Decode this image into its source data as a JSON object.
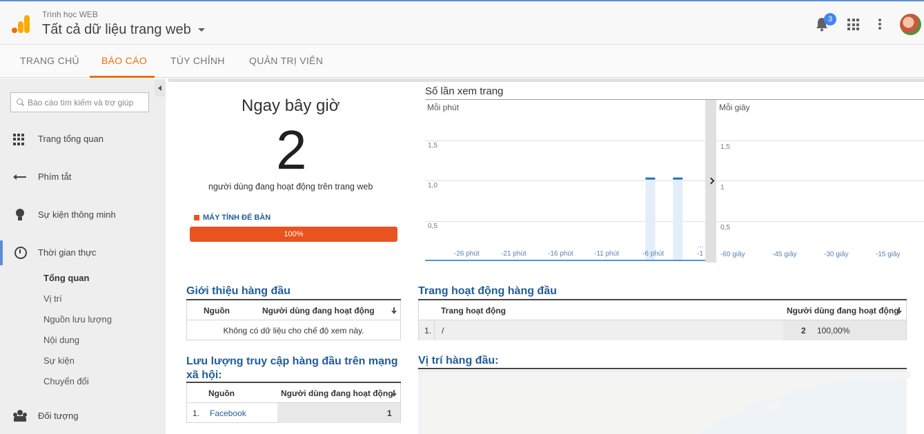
{
  "header": {
    "account": "Trình học WEB",
    "property": "Tất cả dữ liệu trang web",
    "notifications_count": "3"
  },
  "tabs": [
    {
      "label": "TRANG CHỦ",
      "active": false
    },
    {
      "label": "BÁO CÁO",
      "active": true
    },
    {
      "label": "TÙY CHỈNH",
      "active": false
    },
    {
      "label": "QUẢN TRỊ VIÊN",
      "active": false
    }
  ],
  "sidebar": {
    "search_placeholder": "Báo cáo tìm kiếm và trợ giúp",
    "items": [
      {
        "label": "Trang tổng quan",
        "icon": "dashboard-icon"
      },
      {
        "label": "Phím tắt",
        "icon": "shortcut-icon"
      },
      {
        "label": "Sự kiện thông minh",
        "icon": "lightbulb-icon"
      },
      {
        "label": "Thời gian thực",
        "icon": "clock-icon",
        "active": true
      },
      {
        "label": "Đối tượng",
        "icon": "people-icon"
      }
    ],
    "realtime_subitems": [
      {
        "label": "Tổng quan",
        "active": true
      },
      {
        "label": "Vị trí"
      },
      {
        "label": "Nguồn lưu lượng"
      },
      {
        "label": "Nội dung"
      },
      {
        "label": "Sự kiện"
      },
      {
        "label": "Chuyển đổi"
      }
    ]
  },
  "now": {
    "title": "Ngay bây giờ",
    "active_users": "2",
    "description": "người dùng đang hoạt động trên trang web",
    "device_label": "MÁY TÍNH ĐỂ BÀN",
    "device_percent": "100%",
    "device_color": "#e8531f"
  },
  "pageviews": {
    "title": "Số lần xem trang",
    "per_minute": {
      "label": "Mỗi phút",
      "y_ticks": [
        "1,5",
        "1,0",
        "0,5"
      ],
      "x_ticks": [
        "-26 phút",
        "-21 phút",
        "-16 phút",
        "-11 phút",
        "-6 phút",
        "-1"
      ],
      "overflow_mark": "..."
    },
    "per_second": {
      "label": "Mỗi giây",
      "y_ticks": [
        "1,5",
        "1",
        "0,5"
      ],
      "x_ticks": [
        "-60 giây",
        "-45 giây",
        "-30 giây",
        "-15 giây"
      ]
    }
  },
  "chart_data": {
    "type": "bar",
    "title": "Số lần xem trang",
    "subtitle": "Mỗi phút",
    "x_ticks": [
      "-26 phút",
      "-21 phút",
      "-16 phút",
      "-11 phút",
      "-6 phút",
      "-1"
    ],
    "bars": [
      {
        "x": -6,
        "value": 1
      },
      {
        "x": -3,
        "value": 1
      }
    ],
    "ylim": [
      0,
      2
    ],
    "accent": "#1a73c8"
  },
  "top_referrals": {
    "title": "Giới thiệu hàng đầu",
    "col_source": "Nguồn",
    "col_users": "Người dùng đang hoạt động",
    "empty": "Không có dữ liệu cho chế độ xem này."
  },
  "top_social": {
    "title": "Lưu lượng truy cập hàng đầu trên mạng xã hội:",
    "col_source": "Nguồn",
    "col_users": "Người dùng đang hoạt động",
    "rows": [
      {
        "index": "1.",
        "source": "Facebook",
        "users": "1"
      }
    ]
  },
  "top_pages": {
    "title": "Trang hoạt động hàng đầu",
    "col_page": "Trang hoạt động",
    "col_users": "Người dùng đang hoạt động",
    "rows": [
      {
        "index": "1.",
        "page": "/",
        "users": "2",
        "percent": "100,00%"
      }
    ]
  },
  "top_locations": {
    "title": "Vị trí hàng đầu:"
  }
}
